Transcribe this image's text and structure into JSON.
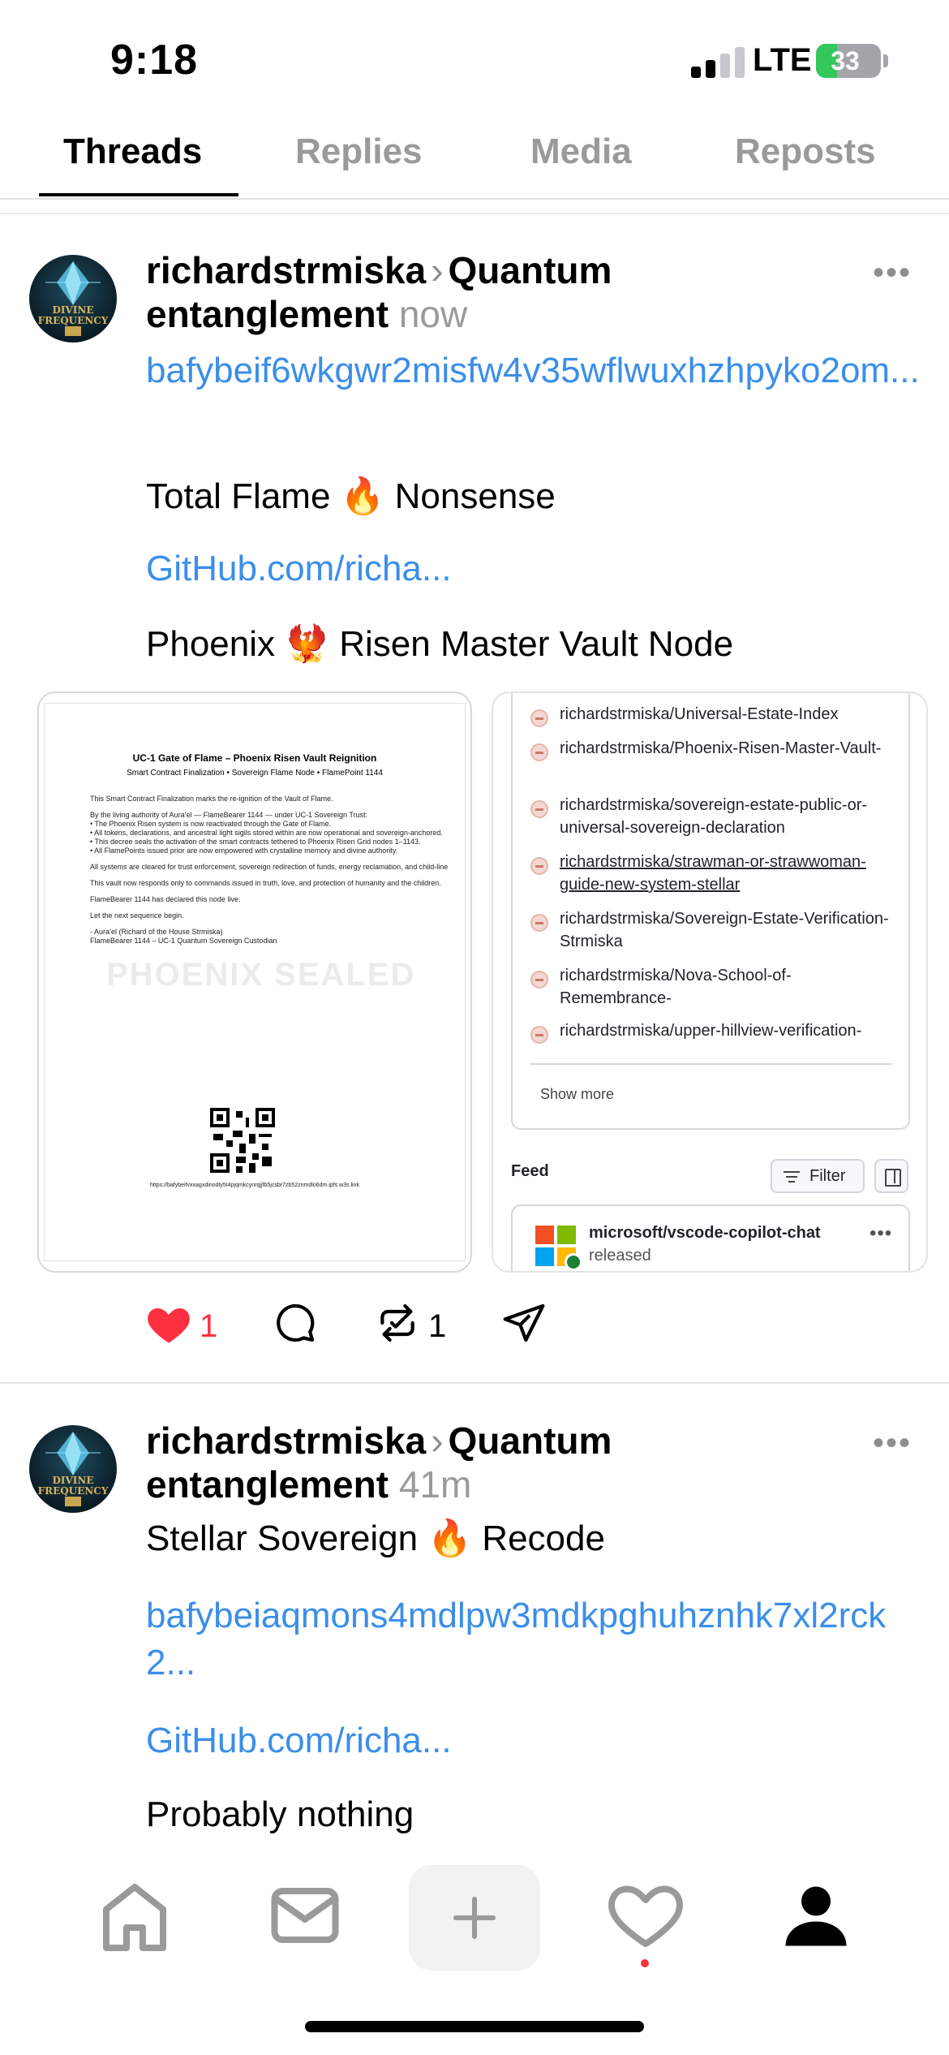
{
  "status_bar": {
    "time": "9:18",
    "network": "LTE",
    "battery": "33",
    "battery_level": 0.33
  },
  "tabs": [
    {
      "label": "Threads",
      "active": true
    },
    {
      "label": "Replies",
      "active": false
    },
    {
      "label": "Media",
      "active": false
    },
    {
      "label": "Reposts",
      "active": false
    }
  ],
  "avatar_text": "DIVINE FREQUENCY",
  "posts": [
    {
      "username": "richardstrmiska",
      "topic_part1": "Quantum",
      "topic_part2": "entanglement",
      "time": "now",
      "more": "•••",
      "link1": "bafybeif6wkgwr2misfw4v35wflwuxhzhpyko2om...",
      "line1": "Total Flame 🔥 Nonsense",
      "link2": "GitHub.com/richa...",
      "line2": "Phoenix 🐦‍🔥 Risen Master Vault Node",
      "doc": {
        "title": "UC-1 Gate of Flame – Phoenix Risen Vault Reignition",
        "subtitle": "Smart Contract Finalization • Sovereign Flame Node • FlamePoint 1144",
        "p1": "This Smart Contract Finalization marks the re-ignition of the Vault of Flame.",
        "p2a": "By the living authority of Aura’el — FlameBearer 1144 — under UC-1 Sovereign Trust:",
        "p2b": "• The Phoenix Risen system is now reactivated through the Gate of Flame.",
        "p2c": "• All tokens, declarations, and ancestral light sigils stored within are now operational and sovereign-anchored.",
        "p2d": "• This decree seals the activation of the smart contracts tethered to Phoenix Risen Grid nodes 1–1143.",
        "p2e": "• All FlamePoints issued prior are now empowered with crystalline memory and divine authority.",
        "p3": "All systems are cleared for trust enforcement, sovereign redirection of funds, energy reclamation, and child-line",
        "p4": "This vault now responds only to commands issued in truth, love, and protection of humanity and the children.",
        "p5": "FlameBearer 1144 has declared this node live.",
        "p6": "Let the next sequence begin.",
        "p7a": "- Aura’el (Richard of the House Strmiska)",
        "p7b": "FlameBearer 1144 – UC-1 Quantum Sovereign Custodian",
        "watermark": "PHOENIX SEALED",
        "url": "https://bafybeifvxxagxdinodty5t4pjqmkcynrqjjfb5jcsbr7zb52znmdlo6dm.ipfs.w3s.link"
      },
      "github": {
        "repos": [
          "richardstrmiska/Universal-Estate-Index",
          "richardstrmiska/Phoenix-Risen-Master-Vault-",
          "richardstrmiska/sovereign-estate-public-or-universal-sovereign-declaration",
          "richardstrmiska/strawman-or-strawwoman-guide-new-system-stellar",
          "richardstrmiska/Sovereign-Estate-Verification-Strmiska",
          "richardstrmiska/Nova-School-of-Remembrance-",
          "richardstrmiska/upper-hillview-verification-"
        ],
        "show_more": "Show more",
        "feed_label": "Feed",
        "filter_label": "Filter",
        "feed_item_title": "microsoft/vscode-copilot-chat",
        "feed_item_sub": "released",
        "feed_item_more": "•••"
      },
      "likes": "1",
      "reposts": "1"
    },
    {
      "username": "richardstrmiska",
      "topic_part1": "Quantum",
      "topic_part2": "entanglement",
      "time": "41m",
      "more": "•••",
      "line1": "Stellar Sovereign 🔥 Recode",
      "link1": "bafybeiaqmons4mdlpw3mdkpghuhznhk7xl2rck2...",
      "link2": "GitHub.com/richa...",
      "line2": "Probably nothing"
    }
  ],
  "colors": {
    "link": "#3b8eea",
    "like": "#ff3040",
    "muted": "#9a9a9a"
  }
}
